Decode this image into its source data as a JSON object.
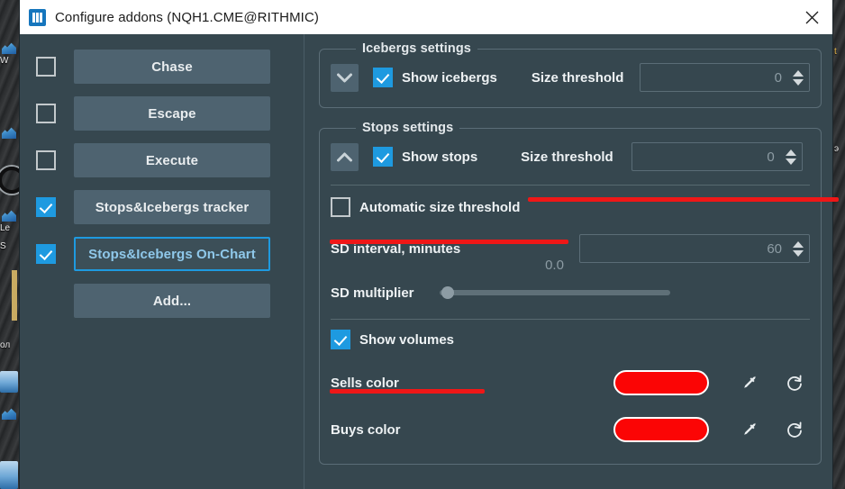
{
  "window": {
    "title": "Configure addons (NQH1.CME@RITHMIC)",
    "app_icon": "columns-icon",
    "close_icon": "close-icon"
  },
  "addons": {
    "items": [
      {
        "label": "Chase",
        "checked": false,
        "selected": false
      },
      {
        "label": "Escape",
        "checked": false,
        "selected": false
      },
      {
        "label": "Execute",
        "checked": false,
        "selected": false
      },
      {
        "label": "Stops&Icebergs tracker",
        "checked": true,
        "selected": false
      },
      {
        "label": "Stops&Icebergs On-Chart",
        "checked": true,
        "selected": true
      }
    ],
    "add_label": "Add..."
  },
  "icebergs": {
    "legend": "Icebergs settings",
    "collapse_icon": "chevron-down-icon",
    "show_label": "Show icebergs",
    "show_checked": true,
    "threshold_label": "Size threshold",
    "threshold_value": "0"
  },
  "stops": {
    "legend": "Stops settings",
    "collapse_icon": "chevron-up-icon",
    "show_label": "Show stops",
    "show_checked": true,
    "threshold_label": "Size threshold",
    "threshold_value": "0",
    "auto_label": "Automatic size threshold",
    "auto_checked": false,
    "sd_interval_label": "SD interval, minutes",
    "sd_interval_value": "60",
    "sd_multiplier_label": "SD multiplier",
    "sd_multiplier_value": "0.0",
    "sd_multiplier_pos_pct": 1,
    "volumes_label": "Show volumes",
    "volumes_checked": true,
    "sells_label": "Sells color",
    "sells_color": "#fb0505",
    "buys_label": "Buys color",
    "buys_color": "#fb0505",
    "picker_icon": "eyedropper-icon",
    "reset_icon": "reset-icon"
  },
  "theme": {
    "window_bg": "#36474f",
    "button_bg": "#4e6370",
    "accent": "#1e9ae0",
    "annotation": "#ef1717",
    "titlebar_bg": "#ffffff"
  },
  "desktop": {
    "labels": [
      "W",
      "Le",
      "S",
      "ол",
      "t",
      "э"
    ]
  }
}
